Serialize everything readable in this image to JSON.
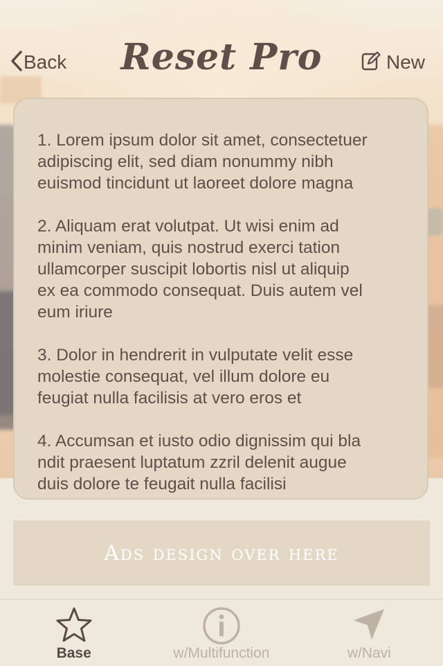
{
  "nav": {
    "back_label": "Back",
    "title": "Reset Pro",
    "new_label": "New"
  },
  "content": {
    "paragraphs": [
      "1. Lorem ipsum dolor sit amet, consectetuer\nadipiscing elit, sed diam nonummy nibh\neuismod tincidunt ut laoreet dolore magna",
      "2. Aliquam erat volutpat. Ut wisi enim ad\nminim veniam, quis nostrud exerci tation\nullamcorper suscipit lobortis nisl ut aliquip\nex ea commodo consequat. Duis autem vel\neum iriure",
      "3. Dolor in hendrerit in vulputate velit esse\nmolestie consequat, vel illum dolore eu\nfeugiat nulla facilisis at vero eros et",
      "4. Accumsan et iusto odio dignissim qui bla\nndit praesent luptatum zzril delenit augue\nduis dolore te feugait nulla facilisi"
    ]
  },
  "ads": {
    "label": "Ads design over here"
  },
  "tabs": [
    {
      "label": "Base",
      "icon": "star-icon",
      "active": true
    },
    {
      "label": "w/Multifunction",
      "icon": "info-icon",
      "active": false
    },
    {
      "label": "w/Navi",
      "icon": "location-arrow-icon",
      "active": false
    }
  ],
  "colors": {
    "text_dark": "#5f4e4a",
    "card_bg": "#e3d8c5",
    "tab_inactive": "#bdb2a4",
    "background": "#efe8dc"
  }
}
